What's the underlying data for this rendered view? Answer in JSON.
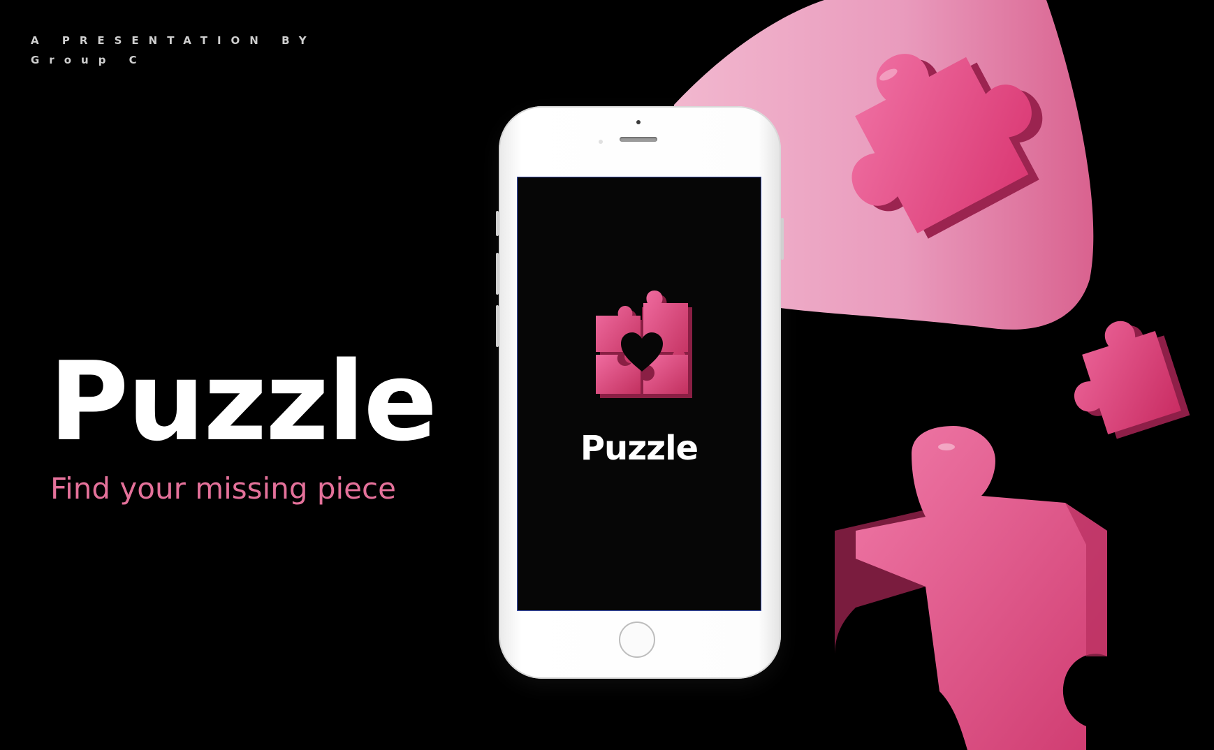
{
  "slide": {
    "byline": [
      "A PRESENTATION BY",
      "Group C"
    ],
    "title": "Puzzle",
    "tagline": "Find your missing piece"
  },
  "phone_app": {
    "title": "Puzzle",
    "logo_icon": "puzzle-heart-icon"
  },
  "colors": {
    "background": "#000000",
    "accent_pink": "#e4719a",
    "puzzle_pink": "#e0467f",
    "blob_pink": "#e79bbb"
  }
}
